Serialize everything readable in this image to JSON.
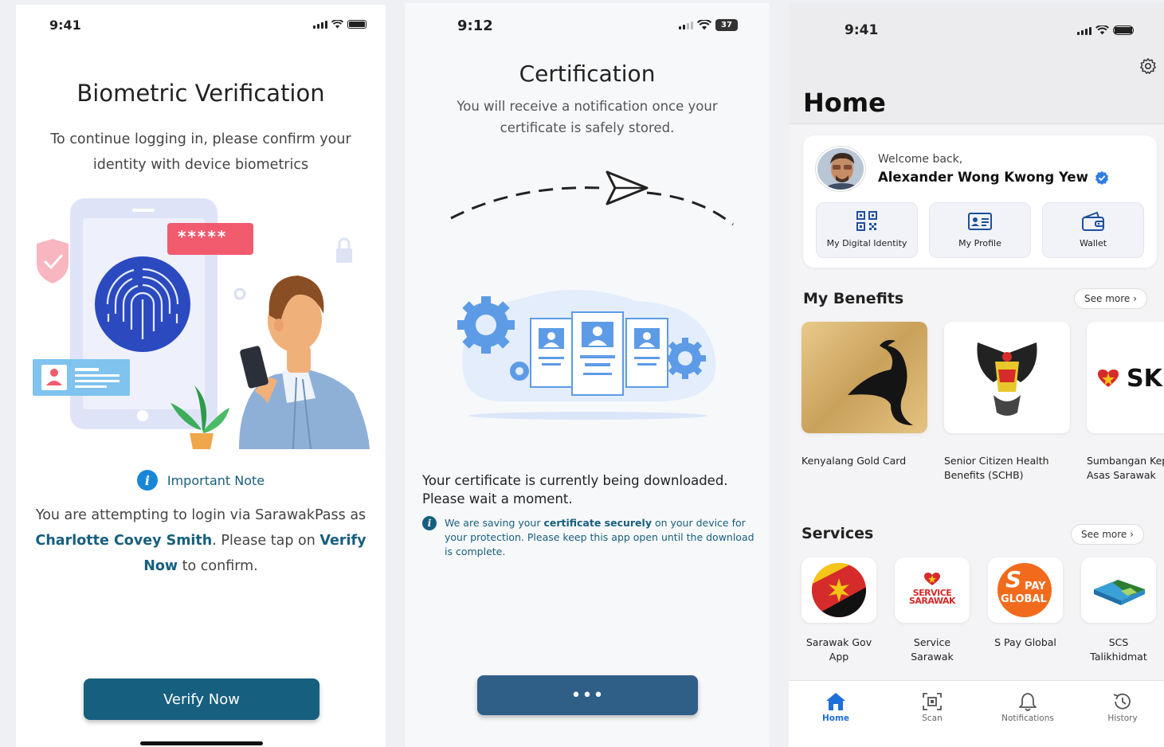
{
  "screen1": {
    "time": "9:41",
    "title": "Biometric Verification",
    "subtitle_line1": "To continue logging in, please confirm your",
    "subtitle_line2": "identity with device biometrics",
    "pin_mask": "*****",
    "note_title": "Important Note",
    "note_part1": "You are attempting to login via SarawakPass as",
    "note_name": "Charlotte Covey Smith",
    "note_part2": ". Please tap on ",
    "note_verify1": "Verify",
    "note_verify2": "Now",
    "note_part3": " to confirm.",
    "button_label": "Verify Now"
  },
  "screen2": {
    "time": "9:12",
    "battery": "37",
    "title": "Certification",
    "subtitle_line1": "You will receive a notification once your",
    "subtitle_line2": "certificate is safely stored.",
    "status_line1": "Your certificate is currently being downloaded.",
    "status_line2": "Please wait a moment.",
    "info_part1": "We are saving your ",
    "info_bold": "certificate securely",
    "info_part2": " on your device for your protection. Please keep this app open until the download is complete.",
    "button_label": "•••"
  },
  "screen3": {
    "time": "9:41",
    "title": "Home",
    "welcome": "Welcome back,",
    "user_name": "Alexander Wong Kwong Yew",
    "quick_actions": [
      "My Digital Identity",
      "My Profile",
      "Wallet"
    ],
    "benefits_title": "My Benefits",
    "see_more": "See more",
    "benefits": [
      "Kenyalang Gold Card",
      "Senior Citizen Health Benefits (SCHB)",
      "Sumbangan Keperluan Asas Sarawak"
    ],
    "benefit_logo_text": "SK",
    "services_title": "Services",
    "services": [
      "Sarawak Gov App",
      "Service Sarawak",
      "S Pay Global",
      "SCS Talikhidmat"
    ],
    "service_logo_text1": "SERVICE",
    "service_logo_text2": "SARAWAK",
    "spay_logo_s": "S",
    "spay_logo_pay": "PAY",
    "spay_logo_global": "GLOBAL",
    "tabs": [
      "Home",
      "Scan",
      "Notifications",
      "History"
    ],
    "colors": {
      "primary": "#175f7e",
      "active_tab": "#1e6fd9",
      "verified": "#2f7de1"
    }
  }
}
